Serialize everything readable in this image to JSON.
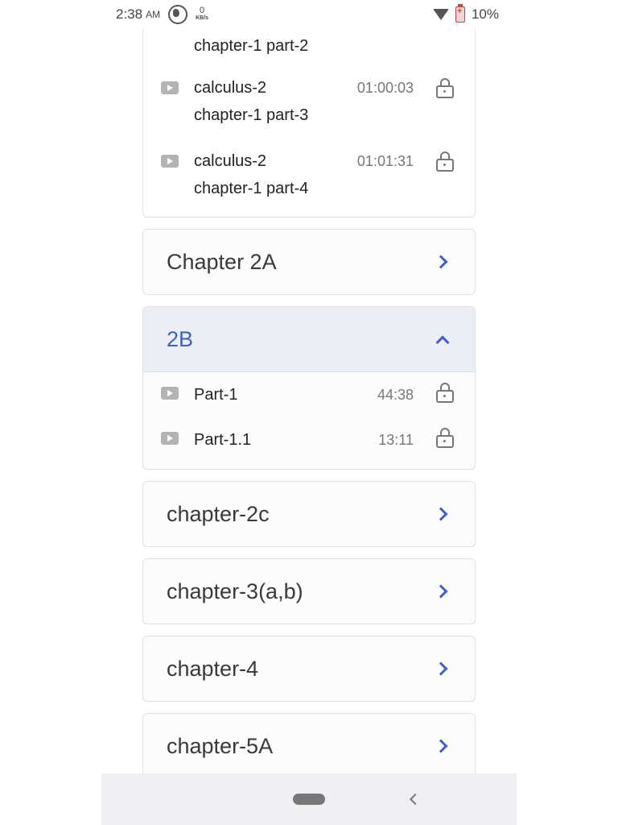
{
  "status": {
    "time": "2:38",
    "ampm": "AM",
    "speed_value": "0",
    "speed_unit": "KB/s",
    "battery_percent": "10%"
  },
  "partial_section": {
    "lessons": [
      {
        "title_line1": "",
        "title_line2": "chapter-1 part-2",
        "duration": ""
      },
      {
        "title_line1": "calculus-2",
        "title_line2": "chapter-1 part-3",
        "duration": "01:00:03"
      },
      {
        "title_line1": "calculus-2",
        "title_line2": "chapter-1 part-4",
        "duration": "01:01:31"
      }
    ]
  },
  "chapters": [
    {
      "title": "Chapter 2A"
    },
    {
      "title": "2B",
      "lessons": [
        {
          "title": "Part-1",
          "duration": "44:38"
        },
        {
          "title": "Part-1.1",
          "duration": "13:11"
        }
      ]
    },
    {
      "title": "chapter-2c"
    },
    {
      "title": "chapter-3(a,b)"
    },
    {
      "title": "chapter-4"
    },
    {
      "title": "chapter-5A"
    }
  ],
  "colors": {
    "accent": "#3f5fc9",
    "open_header_bg": "#eceef6"
  }
}
